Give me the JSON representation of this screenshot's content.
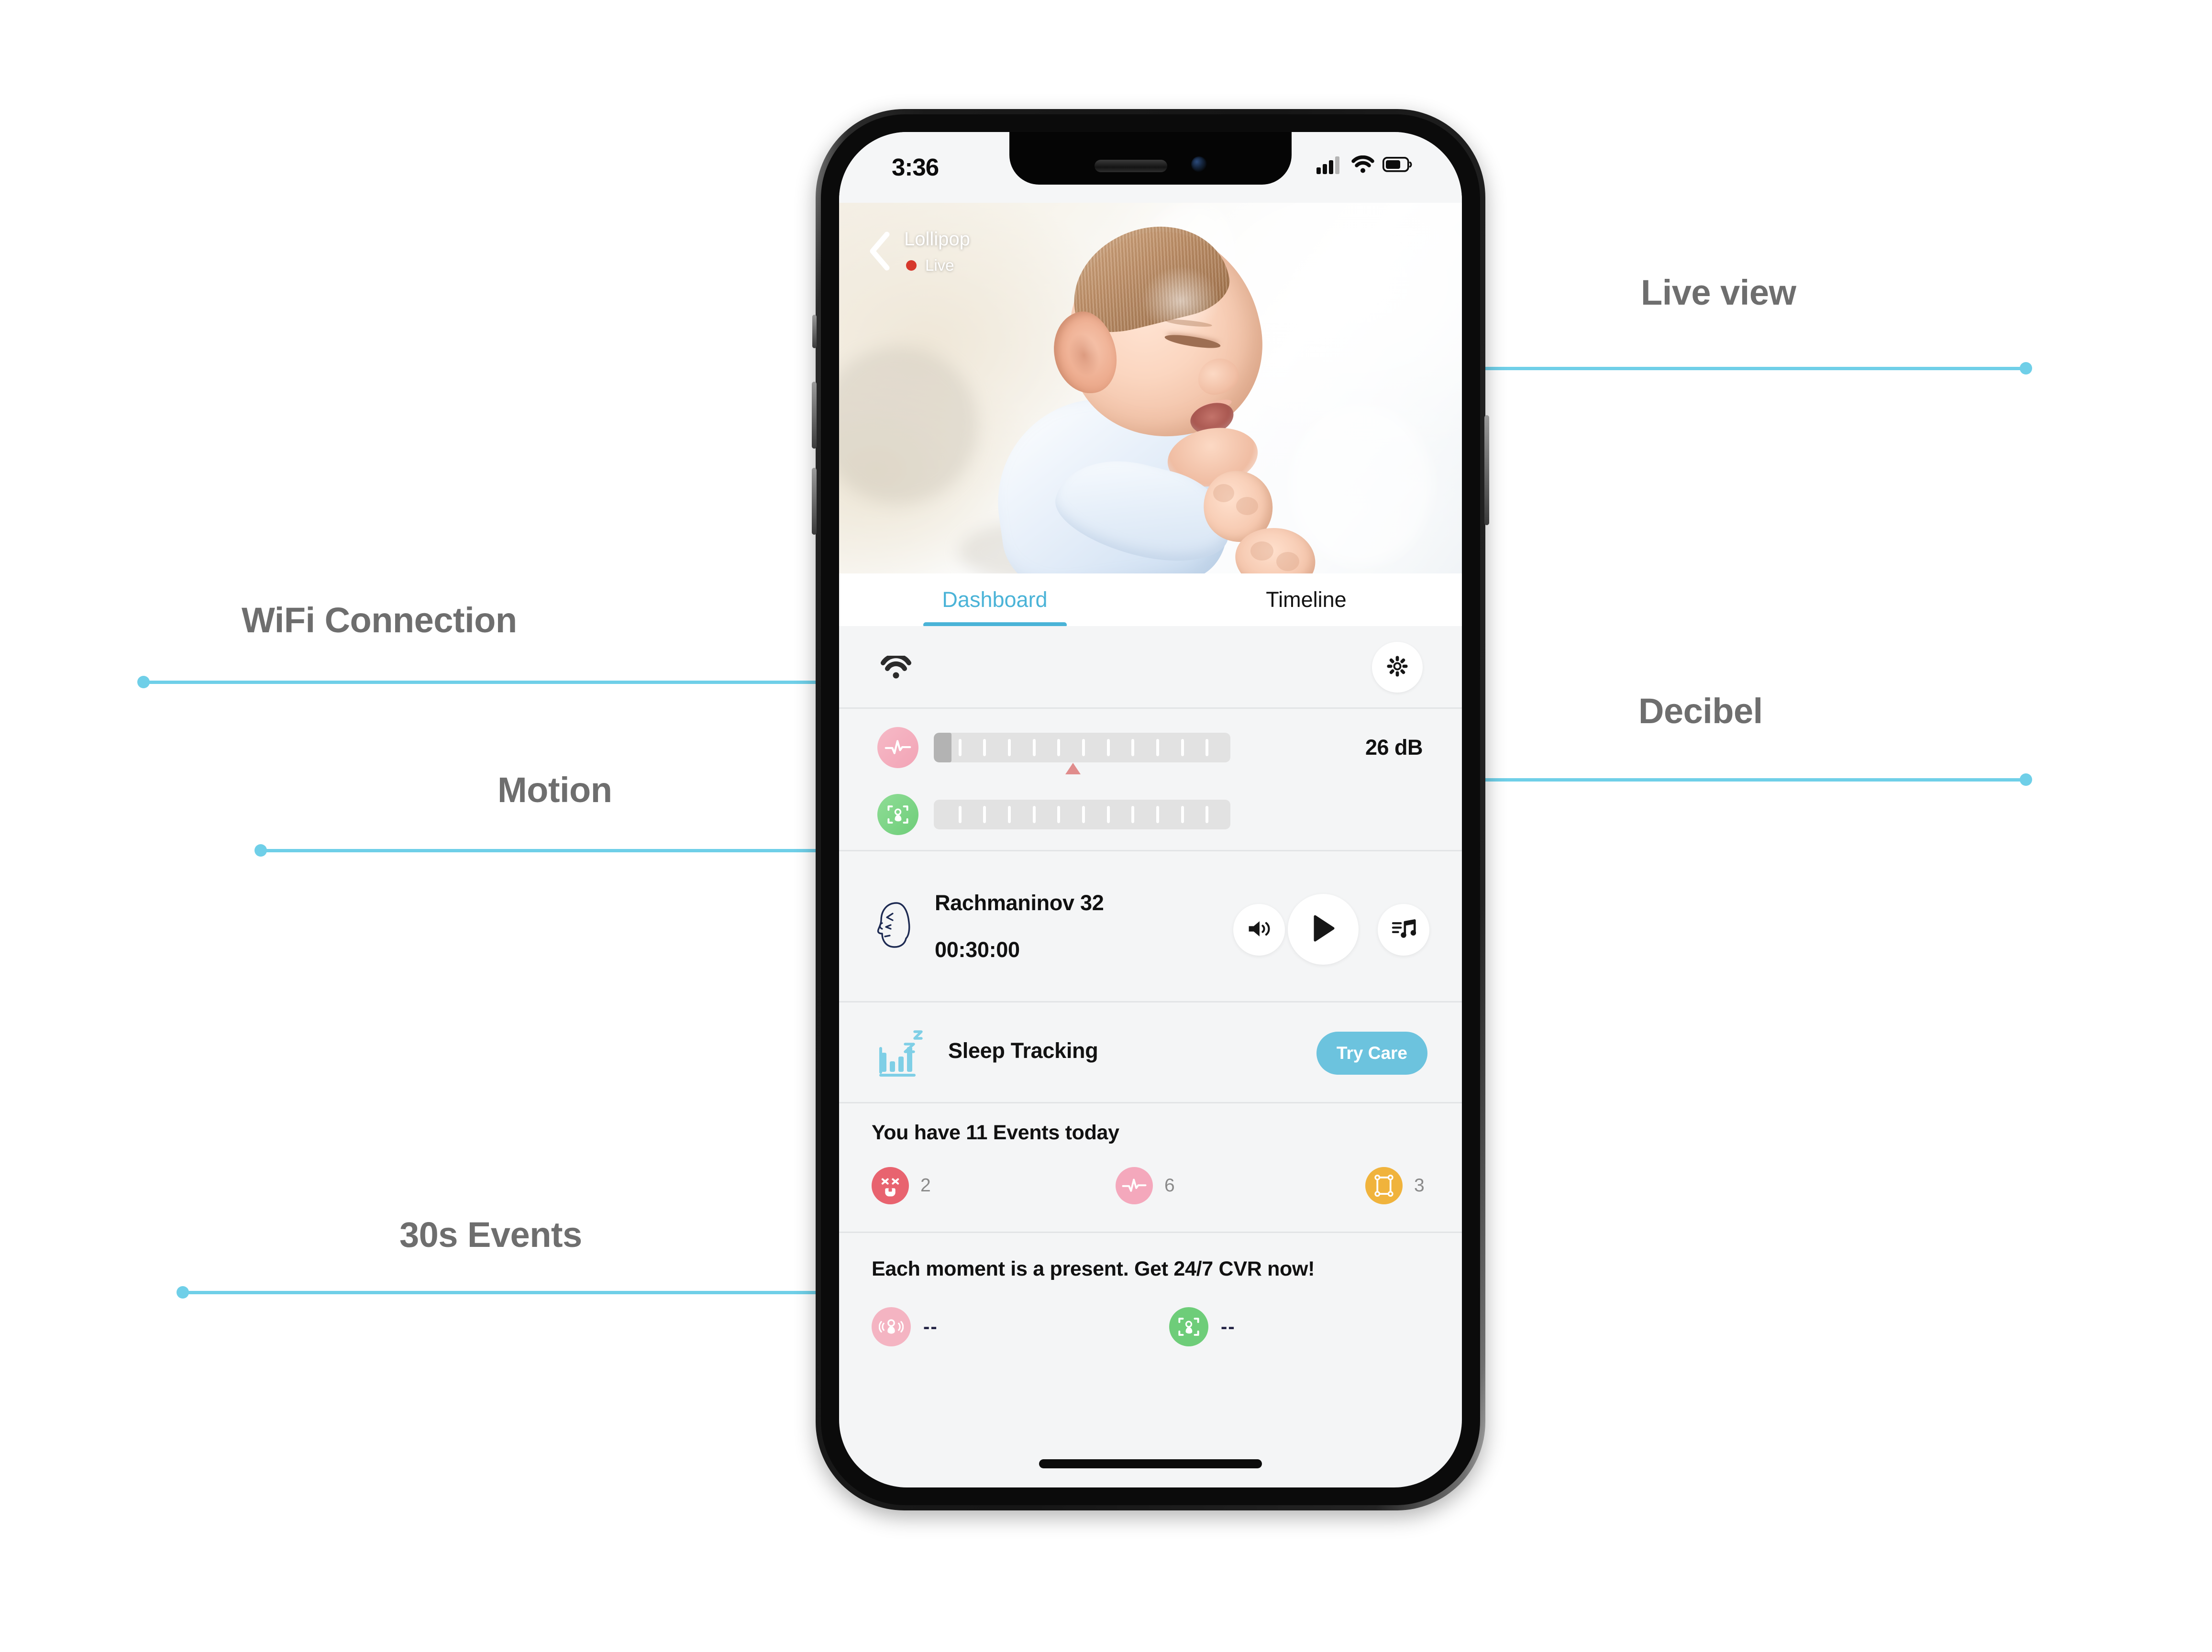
{
  "annotations": [
    {
      "id": "live-view",
      "label": "Live view"
    },
    {
      "id": "decibel",
      "label": "Decibel"
    },
    {
      "id": "wifi-connection",
      "label": "WiFi Connection"
    },
    {
      "id": "motion",
      "label": "Motion"
    },
    {
      "id": "events-30s",
      "label": "30s Events"
    }
  ],
  "status_bar": {
    "time": "3:36",
    "icons": [
      "cellular-signal-icon",
      "wifi-icon",
      "battery-icon"
    ]
  },
  "live_view": {
    "back_icon": "back-chevron-icon",
    "camera_name": "Lollipop",
    "live_label": "Live",
    "live_dot_color": "#d6382c",
    "image": "sleeping-baby-photo"
  },
  "tabs": [
    {
      "label": "Dashboard",
      "active": true
    },
    {
      "label": "Timeline",
      "active": false
    }
  ],
  "tab_accent_color": "#4ab3d7",
  "status_row": {
    "wifi_icon": "wifi-icon",
    "settings_icon": "gear-icon"
  },
  "meters": {
    "sound": {
      "icon": "sound-pulse-icon",
      "icon_color": "#f2a4b6",
      "fill_percent": 6,
      "marker_percent": 47,
      "ticks": 11,
      "value": "26 dB"
    },
    "motion": {
      "icon": "baby-motion-icon",
      "icon_color": "#6ecd79",
      "fill_percent": 0,
      "ticks": 11
    }
  },
  "music": {
    "icon": "composer-face-icon",
    "title": "Rachmaninov 32",
    "time": "00:30:00",
    "controls": [
      {
        "name": "volume-button",
        "icon": "speaker-icon"
      },
      {
        "name": "play-button",
        "icon": "play-icon"
      },
      {
        "name": "playlist-button",
        "icon": "playlist-music-icon"
      }
    ]
  },
  "sleep": {
    "icon": "sleep-chart-zzz-icon",
    "label": "Sleep Tracking",
    "cta_label": "Try Care",
    "cta_color": "#6cc3de"
  },
  "events": {
    "title": "You have 11 Events today",
    "items": [
      {
        "icon": "crying-face-icon",
        "color": "#e8636f",
        "count": "2"
      },
      {
        "icon": "sound-wave-icon",
        "color": "#f4a8bc",
        "count": "6"
      },
      {
        "icon": "rollover-frame-icon",
        "color": "#f0b33c",
        "count": "3"
      }
    ]
  },
  "cvr": {
    "title": "Each moment is a present. Get 24/7 CVR now!",
    "items": [
      {
        "icon": "baby-cry-detect-icon",
        "color": "#f4b4c2",
        "value": "--"
      },
      {
        "icon": "baby-motion-detect-icon",
        "color": "#6ecd79",
        "value": "--"
      }
    ]
  }
}
